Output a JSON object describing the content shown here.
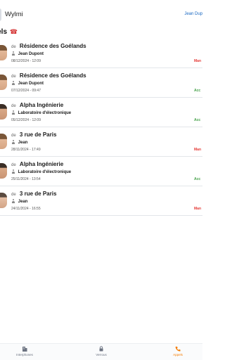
{
  "app": {
    "title": "Wylmi",
    "user": "Jean Dup"
  },
  "section": {
    "title": "pels",
    "icon": "phone-emoji-icon"
  },
  "calls": [
    {
      "de": "de",
      "place": "Résidence des Goélands",
      "person": "Jean Dupont",
      "datetime": "08/12/2024 - 12:09",
      "status": "Man",
      "status_type": "missed",
      "avatar": "avatar-woman"
    },
    {
      "de": "de",
      "place": "Résidence des Goélands",
      "person": "Jean Dupont",
      "datetime": "07/12/2024 - 09:47",
      "status": "Acc",
      "status_type": "accepted",
      "avatar": "avatar-woman"
    },
    {
      "de": "de",
      "place": "Alpha Ingénierie",
      "person": "Laboratoire d'électronique",
      "datetime": "05/12/2024 - 12:09",
      "status": "Acc",
      "status_type": "accepted",
      "avatar": "avatar-man"
    },
    {
      "de": "de",
      "place": "3 rue de Paris",
      "person": "Jean",
      "datetime": "28/11/2024 - 17:49",
      "status": "Man",
      "status_type": "missed",
      "avatar": "avatar-woman"
    },
    {
      "de": "de",
      "place": "Alpha Ingénierie",
      "person": "Laboratoire d'électronique",
      "datetime": "25/11/2024 - 13:54",
      "status": "Acc",
      "status_type": "accepted",
      "avatar": "avatar-man"
    },
    {
      "de": "de",
      "place": "3 rue de Paris",
      "person": "Jean",
      "datetime": "24/11/2024 - 16:55",
      "status": "Man",
      "status_type": "missed",
      "avatar": "avatar-man2"
    }
  ],
  "nav": {
    "items": [
      {
        "label": "Interphones",
        "icon": "building-icon"
      },
      {
        "label": "Verrous",
        "icon": "lock-icon"
      },
      {
        "label": "Appels",
        "icon": "phone-icon"
      }
    ],
    "active_index": 2
  },
  "colors": {
    "missed": "#e53935",
    "accepted": "#43a047",
    "active_nav": "#f57c00",
    "user_link": "#1565c0"
  }
}
